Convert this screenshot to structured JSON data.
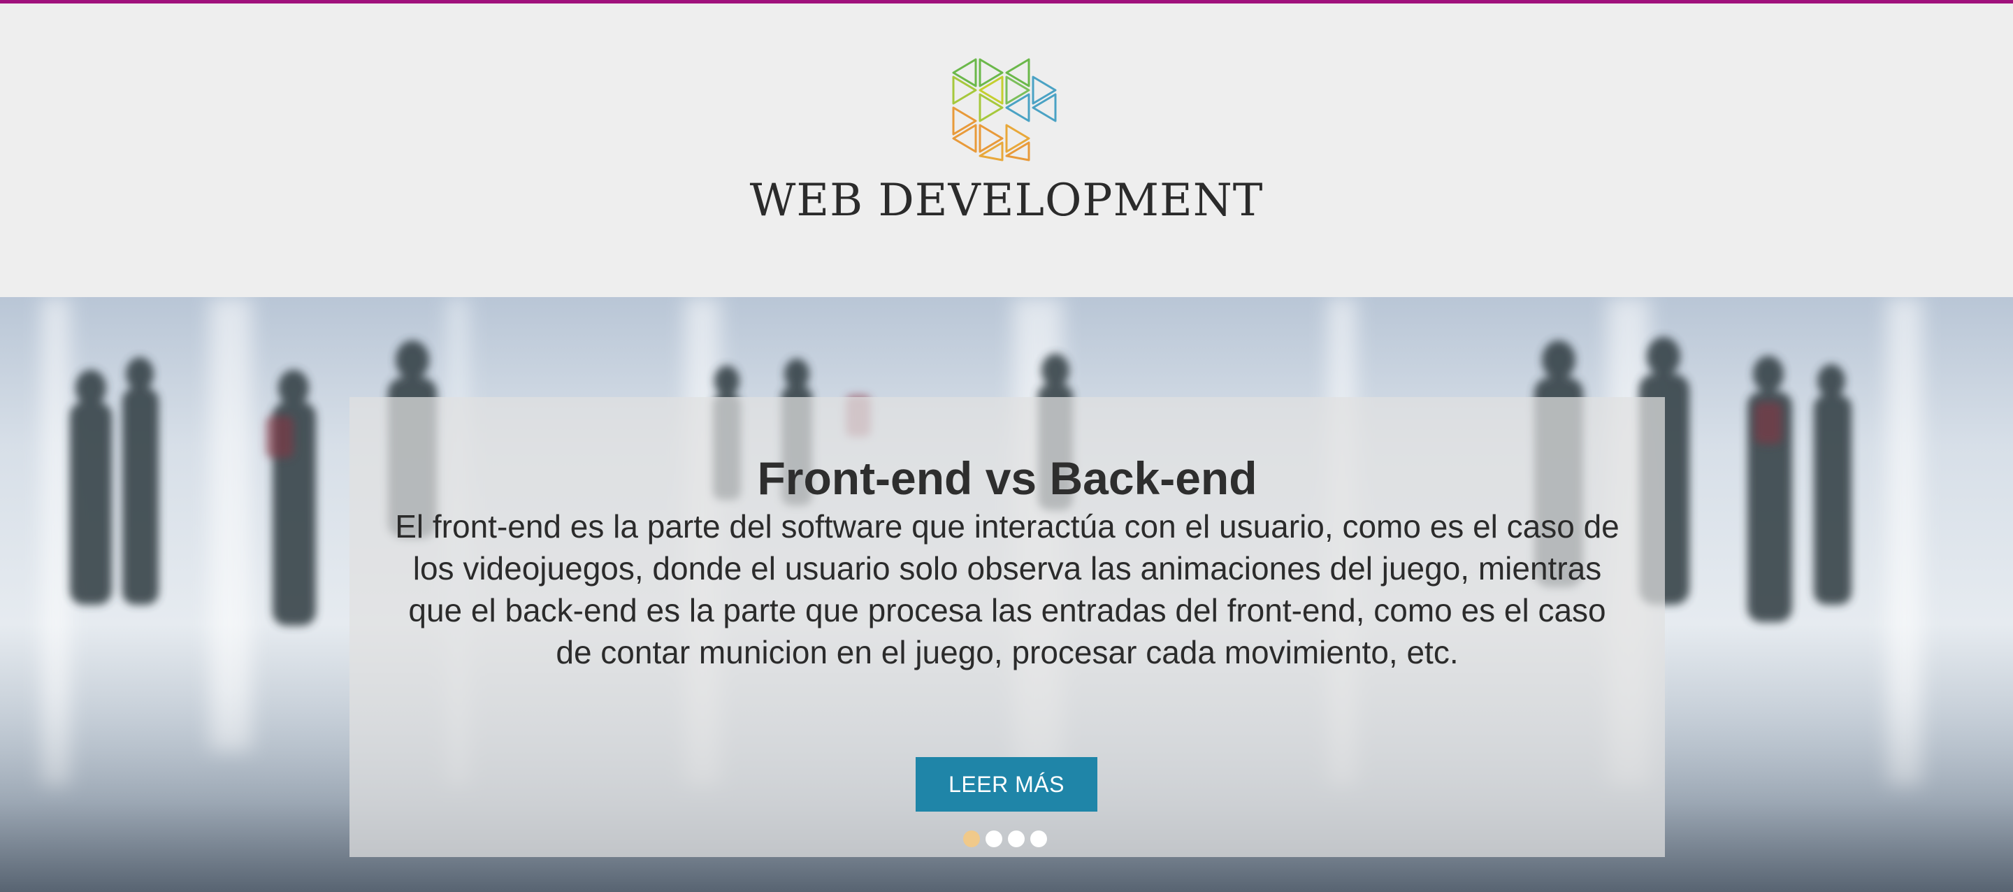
{
  "header": {
    "title": "WEB DEVELOPMENT",
    "logo": "triangle-hexagon-logo",
    "accent_color": "#a0117c"
  },
  "hero": {
    "heading": "Front-end vs Back-end",
    "body": "El front-end es la parte del software que interactúa con el usuario, como es el caso de los videojuegos, donde el usuario solo observa las animaciones del juego, mientras que el back-end es la parte que procesa las entradas del front-end, como es el caso de contar municion en el juego, procesar cada movimiento, etc.",
    "button_label": "LEER MÁS",
    "button_color": "#1f85a8",
    "slider": {
      "count": 4,
      "active_index": 0,
      "active_color": "#f0c98a"
    }
  }
}
